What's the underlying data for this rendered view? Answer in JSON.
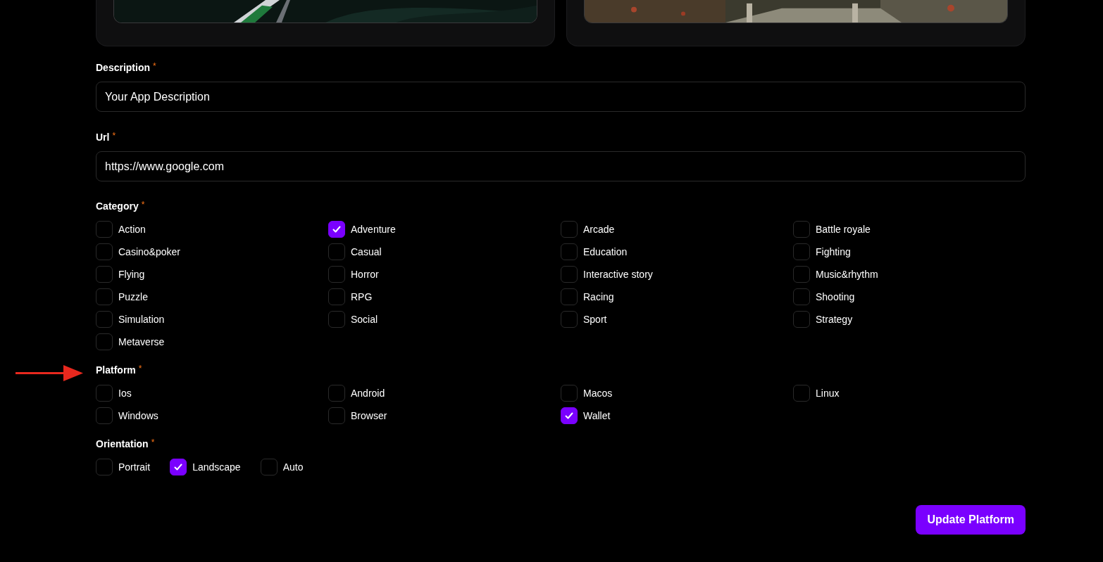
{
  "fields": [
    {
      "label": "Description",
      "required_mark": "*",
      "value": "Your App Description"
    },
    {
      "label": "Url",
      "required_mark": "*",
      "value": "https://www.google.com"
    }
  ],
  "groups": [
    {
      "label": "Category",
      "required_mark": "*",
      "kind": "grid",
      "options": [
        {
          "label": "Action",
          "checked": false
        },
        {
          "label": "Adventure",
          "checked": true
        },
        {
          "label": "Arcade",
          "checked": false
        },
        {
          "label": "Battle royale",
          "checked": false
        },
        {
          "label": "Casino&poker",
          "checked": false
        },
        {
          "label": "Casual",
          "checked": false
        },
        {
          "label": "Education",
          "checked": false
        },
        {
          "label": "Fighting",
          "checked": false
        },
        {
          "label": "Flying",
          "checked": false
        },
        {
          "label": "Horror",
          "checked": false
        },
        {
          "label": "Interactive story",
          "checked": false
        },
        {
          "label": "Music&rhythm",
          "checked": false
        },
        {
          "label": "Puzzle",
          "checked": false
        },
        {
          "label": "RPG",
          "checked": false
        },
        {
          "label": "Racing",
          "checked": false
        },
        {
          "label": "Shooting",
          "checked": false
        },
        {
          "label": "Simulation",
          "checked": false
        },
        {
          "label": "Social",
          "checked": false
        },
        {
          "label": "Sport",
          "checked": false
        },
        {
          "label": "Strategy",
          "checked": false
        },
        {
          "label": "Metaverse",
          "checked": false
        }
      ]
    },
    {
      "label": "Platform",
      "required_mark": "*",
      "kind": "grid",
      "options": [
        {
          "label": "Ios",
          "checked": false
        },
        {
          "label": "Android",
          "checked": false
        },
        {
          "label": "Macos",
          "checked": false
        },
        {
          "label": "Linux",
          "checked": false
        },
        {
          "label": "Windows",
          "checked": false
        },
        {
          "label": "Browser",
          "checked": false
        },
        {
          "label": "Wallet",
          "checked": true
        }
      ]
    },
    {
      "label": "Orientation",
      "required_mark": "*",
      "kind": "row",
      "options": [
        {
          "label": "Portrait",
          "checked": false
        },
        {
          "label": "Landscape",
          "checked": true
        },
        {
          "label": "Auto",
          "checked": false
        }
      ]
    }
  ],
  "submit_button": "Update Platform"
}
